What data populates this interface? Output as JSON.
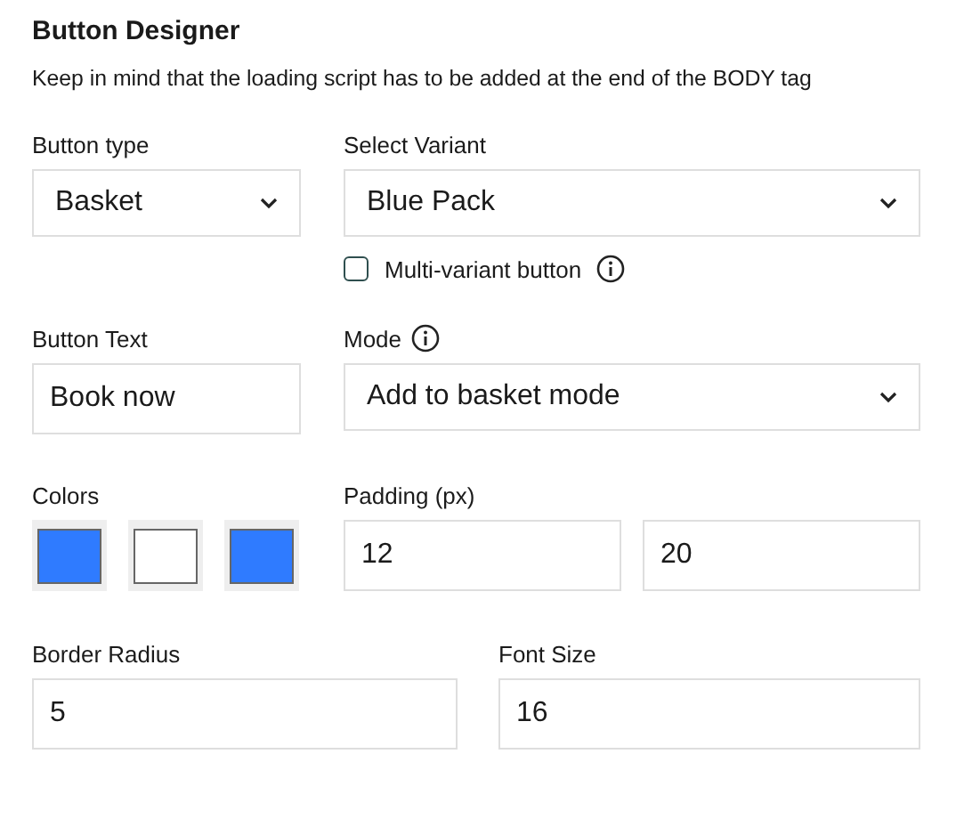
{
  "title": "Button Designer",
  "description": "Keep in mind that the loading script has to be added at the end of the BODY tag",
  "button_type": {
    "label": "Button type",
    "value": "Basket"
  },
  "variant": {
    "label": "Select Variant",
    "value": "Blue Pack"
  },
  "multi_variant": {
    "label": "Multi-variant button",
    "checked": false
  },
  "button_text": {
    "label": "Button Text",
    "value": "Book now"
  },
  "mode": {
    "label": "Mode",
    "value": "Add to basket mode"
  },
  "colors": {
    "label": "Colors",
    "swatches": [
      {
        "color": "#2f7bff"
      },
      {
        "color": "#ffffff"
      },
      {
        "color": "#2f7bff"
      }
    ]
  },
  "padding": {
    "label": "Padding (px)",
    "values": [
      "12",
      "20"
    ]
  },
  "border_radius": {
    "label": "Border Radius",
    "value": "5"
  },
  "font_size": {
    "label": "Font Size",
    "value": "16"
  }
}
